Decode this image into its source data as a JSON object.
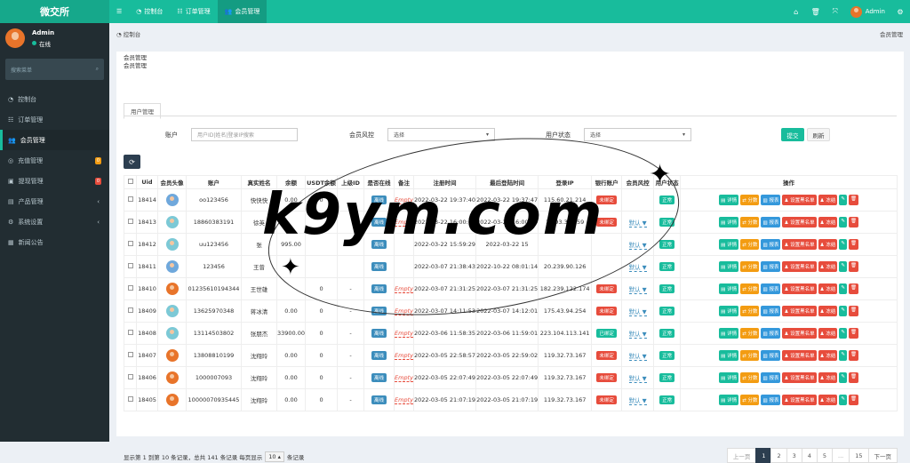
{
  "app": {
    "logo": "微交所"
  },
  "topnav": {
    "items": [
      {
        "label": "控制台",
        "icon": "dashboard-icon"
      },
      {
        "label": "订单管理",
        "icon": "list-icon"
      },
      {
        "label": "会员管理",
        "icon": "users-icon"
      }
    ],
    "admin_name": "Admin"
  },
  "sidebar": {
    "user_name": "Admin",
    "status": "在线",
    "search_placeholder": "搜索菜单",
    "items": [
      {
        "label": "控制台",
        "icon": "dashboard-icon"
      },
      {
        "label": "订单管理",
        "icon": "list-icon"
      },
      {
        "label": "会员管理",
        "icon": "users-icon"
      },
      {
        "label": "充值管理",
        "icon": "deposit-icon",
        "badge": "0"
      },
      {
        "label": "提现管理",
        "icon": "withdraw-icon",
        "badge": "0"
      },
      {
        "label": "产品管理",
        "icon": "product-icon"
      },
      {
        "label": "系统设置",
        "icon": "settings-icon"
      },
      {
        "label": "新闻公告",
        "icon": "news-icon"
      }
    ]
  },
  "breadcrumb": {
    "home": "控制台",
    "current": "会员管理"
  },
  "panel": {
    "title": "会员管理",
    "subtitle": "会员管理",
    "tab": "用户管理"
  },
  "filters": {
    "account_label": "账户",
    "account_placeholder": "用户ID|姓名|登录IP搜索",
    "risk_label": "会员风控",
    "risk_value": "选择",
    "status_label": "用户状态",
    "status_value": "选择",
    "submit": "提交",
    "reset": "刷新"
  },
  "table": {
    "headers": [
      "Uid",
      "会员头像",
      "账户",
      "真实姓名",
      "余额",
      "USDT余额",
      "上级ID",
      "是否在线",
      "备注",
      "注册时间",
      "最后登陆时间",
      "登录IP",
      "银行账户",
      "会员风控",
      "用户状态",
      "操作"
    ],
    "rows": [
      {
        "uid": "18414",
        "avatar": "blue",
        "account": "oo123456",
        "name": "快快快",
        "balance": "0.00",
        "usdt": "0",
        "parent": "",
        "online": "离线",
        "note": "Empty",
        "reg": "2022-03-22 19:37:40",
        "last": "2022-03-22 19:37:47",
        "ip": "115.60.21.214",
        "bank": "未绑定",
        "risk": "",
        "status": "正常"
      },
      {
        "uid": "18413",
        "avatar": "teal",
        "account": "18860383191",
        "name": "徐英",
        "balance": "",
        "usdt": "",
        "parent": "",
        "online": "离线",
        "note": "Empty",
        "reg": "2022-03-22 16:00:15",
        "last": "2022-03-22 16:00:24",
        "ip": "1.193.37.159",
        "bank": "未绑定",
        "risk": "默认",
        "status": "正常"
      },
      {
        "uid": "18412",
        "avatar": "teal",
        "account": "uu123456",
        "name": "张",
        "balance": "995.00",
        "usdt": "",
        "parent": "",
        "online": "离线",
        "note": "",
        "reg": "2022-03-22 15:59:29",
        "last": "2022-03-22 15",
        "ip": "",
        "bank": "",
        "risk": "默认",
        "status": "正常"
      },
      {
        "uid": "18411",
        "avatar": "blue",
        "account": "123456",
        "name": "王曾",
        "balance": "",
        "usdt": "",
        "parent": "",
        "online": "离线",
        "note": "",
        "reg": "2022-03-07 21:38:43",
        "last": "2022-10-22 08:01:14",
        "ip": "20.239.90.126",
        "bank": "",
        "risk": "默认",
        "status": "正常"
      },
      {
        "uid": "18410",
        "avatar": "orange",
        "account": "01235610194344",
        "name": "王世雄",
        "balance": "",
        "usdt": "0",
        "parent": "-",
        "online": "离线",
        "note": "Empty",
        "reg": "2022-03-07 21:31:25",
        "last": "2022-03-07 21:31:25",
        "ip": "182.239.122.174",
        "bank": "未绑定",
        "risk": "默认",
        "status": "正常"
      },
      {
        "uid": "18409",
        "avatar": "teal",
        "account": "13625970348",
        "name": "蒋冰清",
        "balance": "0.00",
        "usdt": "0",
        "parent": "-",
        "online": "离线",
        "note": "Empty",
        "reg": "2022-03-07 14:11:53",
        "last": "2022-03-07 14:12:01",
        "ip": "175.43.94.254",
        "bank": "未绑定",
        "risk": "默认",
        "status": "正常"
      },
      {
        "uid": "18408",
        "avatar": "teal",
        "account": "13114503802",
        "name": "张朋杰",
        "balance": "33900.00",
        "usdt": "0",
        "parent": "-",
        "online": "离线",
        "note": "Empty",
        "reg": "2022-03-06 11:58:35",
        "last": "2022-03-06 11:59:01",
        "ip": "223.104.113.141",
        "bank": "已绑定",
        "risk": "默认",
        "status": "正常"
      },
      {
        "uid": "18407",
        "avatar": "orange",
        "account": "13808810199",
        "name": "沈翔玲",
        "balance": "0.00",
        "usdt": "0",
        "parent": "-",
        "online": "离线",
        "note": "Empty",
        "reg": "2022-03-05 22:58:57",
        "last": "2022-03-05 22:59:02",
        "ip": "119.32.73.167",
        "bank": "未绑定",
        "risk": "默认",
        "status": "正常"
      },
      {
        "uid": "18406",
        "avatar": "orange",
        "account": "1000007093",
        "name": "沈翔玲",
        "balance": "0.00",
        "usdt": "0",
        "parent": "-",
        "online": "离线",
        "note": "Empty",
        "reg": "2022-03-05 22:07:49",
        "last": "2022-03-05 22:07:49",
        "ip": "119.32.73.167",
        "bank": "未绑定",
        "risk": "默认",
        "status": "正常"
      },
      {
        "uid": "18405",
        "avatar": "orange",
        "account": "10000070935445",
        "name": "沈翔玲",
        "balance": "0.00",
        "usdt": "0",
        "parent": "-",
        "online": "离线",
        "note": "Empty",
        "reg": "2022-03-05 21:07:19",
        "last": "2022-03-05 21:07:19",
        "ip": "119.32.73.167",
        "bank": "未绑定",
        "risk": "默认",
        "status": "正常"
      }
    ],
    "ops": [
      "详情",
      "分数",
      "报表",
      "设置黑名单",
      "冻结"
    ]
  },
  "footer": {
    "info_prefix": "显示第 1 到第 10 条记录，总共 141 条记录 每页显示",
    "page_size": "10",
    "info_suffix": "条记录"
  },
  "pagination": [
    "上一页",
    "1",
    "2",
    "3",
    "4",
    "5",
    "...",
    "15",
    "下一页"
  ],
  "watermark": "k9ym.com"
}
